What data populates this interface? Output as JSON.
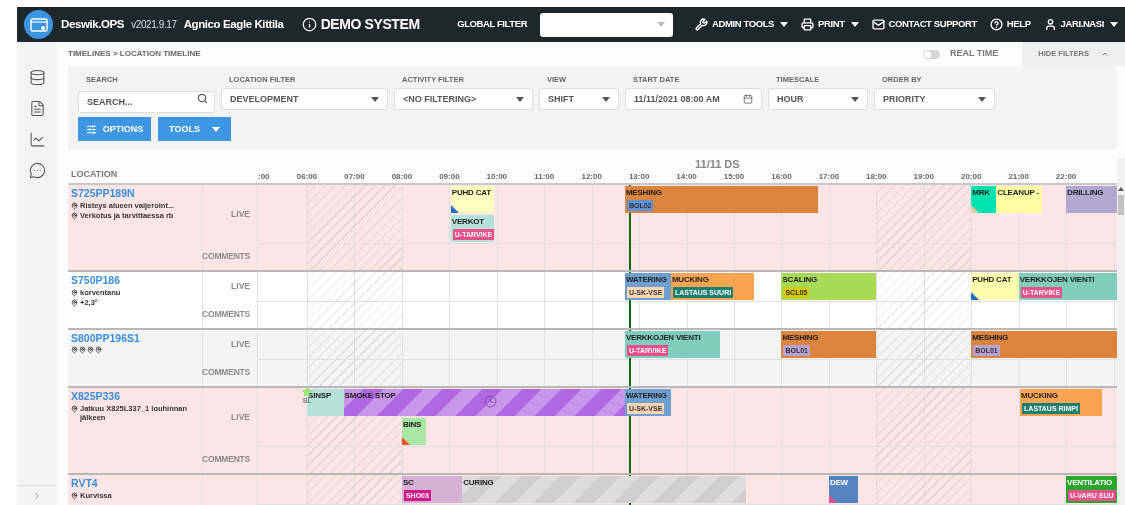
{
  "topbar": {
    "app_name": "Deswik.OPS",
    "version": "v2021.9.17",
    "site": "Agnico Eagle Kittila",
    "system_label": "DEMO SYSTEM",
    "global_filter_label": "GLOBAL FILTER",
    "menu": [
      {
        "label": "ADMIN TOOLS",
        "dropdown": true
      },
      {
        "label": "PRINT",
        "dropdown": true
      },
      {
        "label": "CONTACT SUPPORT",
        "dropdown": false
      },
      {
        "label": "HELP",
        "dropdown": false
      },
      {
        "label": "JARI.NASI",
        "dropdown": true
      }
    ]
  },
  "breadcrumb": "TIMELINES > LOCATION TIMELINE",
  "real_time": {
    "label": "REAL TIME",
    "on": false
  },
  "hide_filters": "HIDE FILTERS",
  "filters": [
    {
      "label": "SEARCH",
      "kind": "search",
      "placeholder": "SEARCH..."
    },
    {
      "label": "LOCATION FILTER",
      "kind": "select",
      "value": "DEVELOPMENT"
    },
    {
      "label": "ACTIVITY FILTER",
      "kind": "select",
      "value": "<NO FILTERING>"
    },
    {
      "label": "VIEW",
      "kind": "select",
      "value": "SHIFT"
    },
    {
      "label": "START DATE",
      "kind": "date",
      "value": "11/11/2021 08:00 AM"
    },
    {
      "label": "TIMESCALE",
      "kind": "select",
      "value": "HOUR"
    },
    {
      "label": "ORDER BY",
      "kind": "select",
      "value": "PRIORITY"
    }
  ],
  "buttons": [
    {
      "label": "OPTIONS",
      "kind": "options"
    },
    {
      "label": "TOOLS",
      "kind": "dropdown"
    }
  ],
  "timeline": {
    "location_heading": "LOCATION",
    "day_label": "11/11 DS",
    "hours": [
      ":00",
      "06:00",
      "07:00",
      "08:00",
      "09:00",
      "10:00",
      "11:00",
      "12:00",
      "13:00",
      "14:00",
      "15:00",
      "16:00",
      "17:00",
      "18:00",
      "19:00",
      "20:00",
      "21:00",
      "22:00"
    ],
    "rows": [
      {
        "name": "S725PP189N",
        "color": "#fde4e5",
        "live_label": "LIVE",
        "comments_label": "COMMENTS",
        "locations": [
          {
            "kind": "note",
            "text": "Risteys alueen vaijeroint..."
          },
          {
            "kind": "note",
            "text": "Verkotus ja tarvittaessa rb"
          }
        ],
        "events": [
          {
            "label": "PUHD CAT",
            "color": "#ffffc0",
            "light_text": false,
            "flag": {
              "color": "#1f6fc8"
            }
          },
          {
            "label": "VERKOT",
            "color": "#b5e2d8",
            "light_text": false,
            "tag": {
              "text": "U-TARVIKE",
              "color": "#e8508a",
              "light_text": true
            }
          },
          {
            "label": "MESHING",
            "color": "#da843e",
            "light_text": false,
            "tag": {
              "text": "BOL02",
              "color": "#5f93d3",
              "light_text": false
            }
          },
          {
            "label": "MRK",
            "color": "#00e3b0",
            "light_text": false,
            "flag": {
              "color": "#f3c9a0"
            }
          },
          {
            "label": "CLEANUP -",
            "color": "#ffffa6",
            "light_text": false
          },
          {
            "label": "DRILLING",
            "color": "#b1a9d0",
            "light_text": false
          }
        ]
      },
      {
        "name": "S750P186",
        "color": "#ffffff",
        "live_label": "LIVE",
        "comments_label": "COMMENTS",
        "locations": [
          {
            "kind": "note",
            "text": "korventanu"
          },
          {
            "kind": "note",
            "text": "+2,3°"
          }
        ],
        "events": [
          {
            "label": "WATERING",
            "color": "#6e9fcf",
            "light_text": false,
            "tag": {
              "text": "U-SK-VSE",
              "color": "#fcd5b2",
              "light_text": false
            }
          },
          {
            "label": "MUCKING",
            "color": "#fba552",
            "light_text": false,
            "tag": {
              "text": "LASTAUS SUURI",
              "color": "#1e7f6f",
              "light_text": true
            }
          },
          {
            "label": "SCALING",
            "color": "#a8d957",
            "light_text": false,
            "tag": {
              "text": "SCL05",
              "color": "#d3c80f",
              "light_text": false
            }
          },
          {
            "label": "PUHD CAT",
            "color": "#ffffb0",
            "light_text": false,
            "flag": {
              "color": "#1f6fc8"
            }
          },
          {
            "label": "VERKKOJEN VIENTI",
            "color": "#7fcdba",
            "light_text": false,
            "tag": {
              "text": "U-TARVIKE",
              "color": "#e8508a",
              "light_text": true
            }
          }
        ]
      },
      {
        "name": "S800PP196S1",
        "color": "#f4f4f4",
        "live_label": "LIVE",
        "comments_label": "COMMENTS",
        "locations": [
          {
            "kind": "pin"
          },
          {
            "kind": "pin"
          },
          {
            "kind": "pin"
          },
          {
            "kind": "pin"
          }
        ],
        "events": [
          {
            "label": "VERKKOJEN VIENTI",
            "color": "#7fcdba",
            "light_text": false,
            "tag": {
              "text": "U-TARVIKE",
              "color": "#e8508a",
              "light_text": true
            }
          },
          {
            "label": "MESHING",
            "color": "#da843e",
            "light_text": false,
            "tag": {
              "text": "BOL01",
              "color": "#b9a2d3",
              "light_text": false
            }
          },
          {
            "label": "MESHING",
            "color": "#da843e",
            "light_text": false,
            "tag": {
              "text": "BOL01",
              "color": "#b9a2d3",
              "light_text": false
            }
          }
        ]
      },
      {
        "name": "X825P336",
        "color": "#fde4e5",
        "live_label": "LIVE",
        "comments_label": "COMMENTS",
        "locations": [
          {
            "kind": "note",
            "text": "Jatkuu X825L337_1 louhinnan jälkeen"
          }
        ],
        "events": [
          {
            "label": "SINSP",
            "color": "#b6e2db",
            "light_text": false,
            "marker": "BL"
          },
          {
            "label": "SMOKE STOP",
            "color": "#b068e0",
            "light_text": false,
            "striped": true,
            "clock": true
          },
          {
            "label": "BINS",
            "color": "#a9e6a3",
            "light_text": false,
            "flag": {
              "color": "#e8541c"
            }
          },
          {
            "label": "WATERING",
            "color": "#6e9fcf",
            "light_text": false,
            "tag": {
              "text": "U-SK-VSE",
              "color": "#fcd5b2",
              "light_text": false
            }
          },
          {
            "label": "MUCKING",
            "color": "#fba552",
            "light_text": false,
            "tag": {
              "text": "LASTAUS RIMPI",
              "color": "#1e7f6f",
              "light_text": true
            }
          }
        ]
      },
      {
        "name": "RVT4",
        "color": "#fde4e5",
        "locations": [
          {
            "kind": "note",
            "text": "Kurvissa"
          }
        ],
        "events": [
          {
            "label": "SC",
            "color": "#d6b1d6",
            "light_text": false,
            "tag": {
              "text": "SHO03",
              "color": "#d3168a",
              "light_text": true
            }
          },
          {
            "label": "CURING",
            "color": "#cfcfcf",
            "light_text": false,
            "striped": true
          },
          {
            "label": "DEW",
            "color": "#5584c0",
            "light_text": true,
            "flag": {
              "color": "#e8508a"
            }
          },
          {
            "label": "VENTILATIO",
            "color": "#2ba52b",
            "light_text": true,
            "tag": {
              "text": "U-VARU SUU",
              "color": "#e8508a",
              "light_text": true
            }
          }
        ]
      }
    ]
  }
}
